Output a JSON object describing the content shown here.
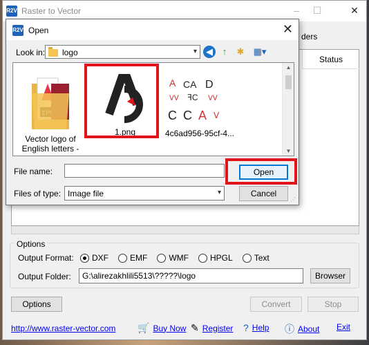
{
  "app": {
    "icon_text": "R2V",
    "title": "Raster to Vector",
    "window_controls": [
      "–",
      "☐",
      "✕"
    ],
    "list_header_partial": "ders",
    "status_header": "Status"
  },
  "options": {
    "legend": "Options",
    "output_format_label": "Output Format:",
    "formats": [
      {
        "label": "DXF",
        "checked": true
      },
      {
        "label": "EMF",
        "checked": false
      },
      {
        "label": "WMF",
        "checked": false
      },
      {
        "label": "HPGL",
        "checked": false
      },
      {
        "label": "Text",
        "checked": false
      }
    ],
    "output_folder_label": "Output Folder:",
    "output_folder_value": "G:\\alirezakhlili5513\\?????\\logo",
    "browser_button": "Browser"
  },
  "buttons": {
    "options": "Options",
    "convert": "Convert",
    "stop": "Stop"
  },
  "footer": {
    "url": "http://www.raster-vector.com",
    "buy_now": "Buy Now",
    "register": "Register",
    "help": "Help",
    "about": "About",
    "exit": "Exit"
  },
  "dialog": {
    "icon_text": "R2V",
    "title": "Open",
    "close": "✕",
    "look_in_label": "Look in:",
    "look_in_value": "logo",
    "files": [
      {
        "name_line1": "Vector logo of",
        "name_line2": "English letters -"
      },
      {
        "name_line1": "1.png",
        "name_line2": ""
      },
      {
        "name_line1": "4c6ad956-95cf-4...",
        "name_line2": ""
      }
    ],
    "file_name_label": "File name:",
    "file_name_value": "",
    "files_of_type_label": "Files of type:",
    "files_of_type_value": "Image file",
    "open_button": "Open",
    "cancel_button": "Cancel"
  },
  "colors": {
    "highlight": "#e0141b",
    "accent_blue": "#0078d7",
    "link": "#0000ee"
  }
}
